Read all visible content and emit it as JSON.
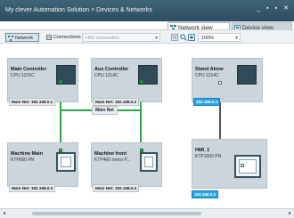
{
  "window": {
    "title": "My clever Automation Solution > Devices & Networks",
    "controls": [
      "_",
      "▪",
      "▪",
      "✕"
    ]
  },
  "view_tabs": [
    {
      "label": "Network view",
      "icon": "network-view-icon",
      "active": true
    },
    {
      "label": "Device view",
      "icon": "device-view-icon",
      "active": false
    }
  ],
  "toolbar": {
    "network_label": "Network",
    "connections_label": "Connections",
    "connection_type_placeholder": "HMI connection",
    "zoom_value": "100%"
  },
  "devices": {
    "main_controller": {
      "name": "Main Controller",
      "type": "CPU 1215C",
      "interface": "Main Net: 192.168.0.1"
    },
    "aux_controller": {
      "name": "Aux Controller",
      "type": "CPU 1214C",
      "interface": "Main Net: 192.168.0.2"
    },
    "stand_alone": {
      "name": "Stand Alone",
      "type": "CPU 1214C",
      "interface": "192.168.0.1"
    },
    "machine_main": {
      "name": "Machine Main",
      "type": "KTP600 PN",
      "interface": "Main Net: 192.168.0.3"
    },
    "machine_front": {
      "name": "Machine front",
      "type": "KTP400 mono P...",
      "interface": "Main Net: 192.168.0.4"
    },
    "hmi_1": {
      "name": "HMI_1",
      "type": "KTP1000 PN",
      "interface": "192.168.0.2"
    }
  },
  "subnet": {
    "label": "Main Net"
  },
  "colors": {
    "titlebar": "#3f6378",
    "device_box": "#ccd5dc",
    "network_line": "#2ba84a",
    "ip_highlight": "#29a6e3"
  },
  "scrollbar": {
    "left_arrow": "◂",
    "right_arrow": "▸"
  }
}
